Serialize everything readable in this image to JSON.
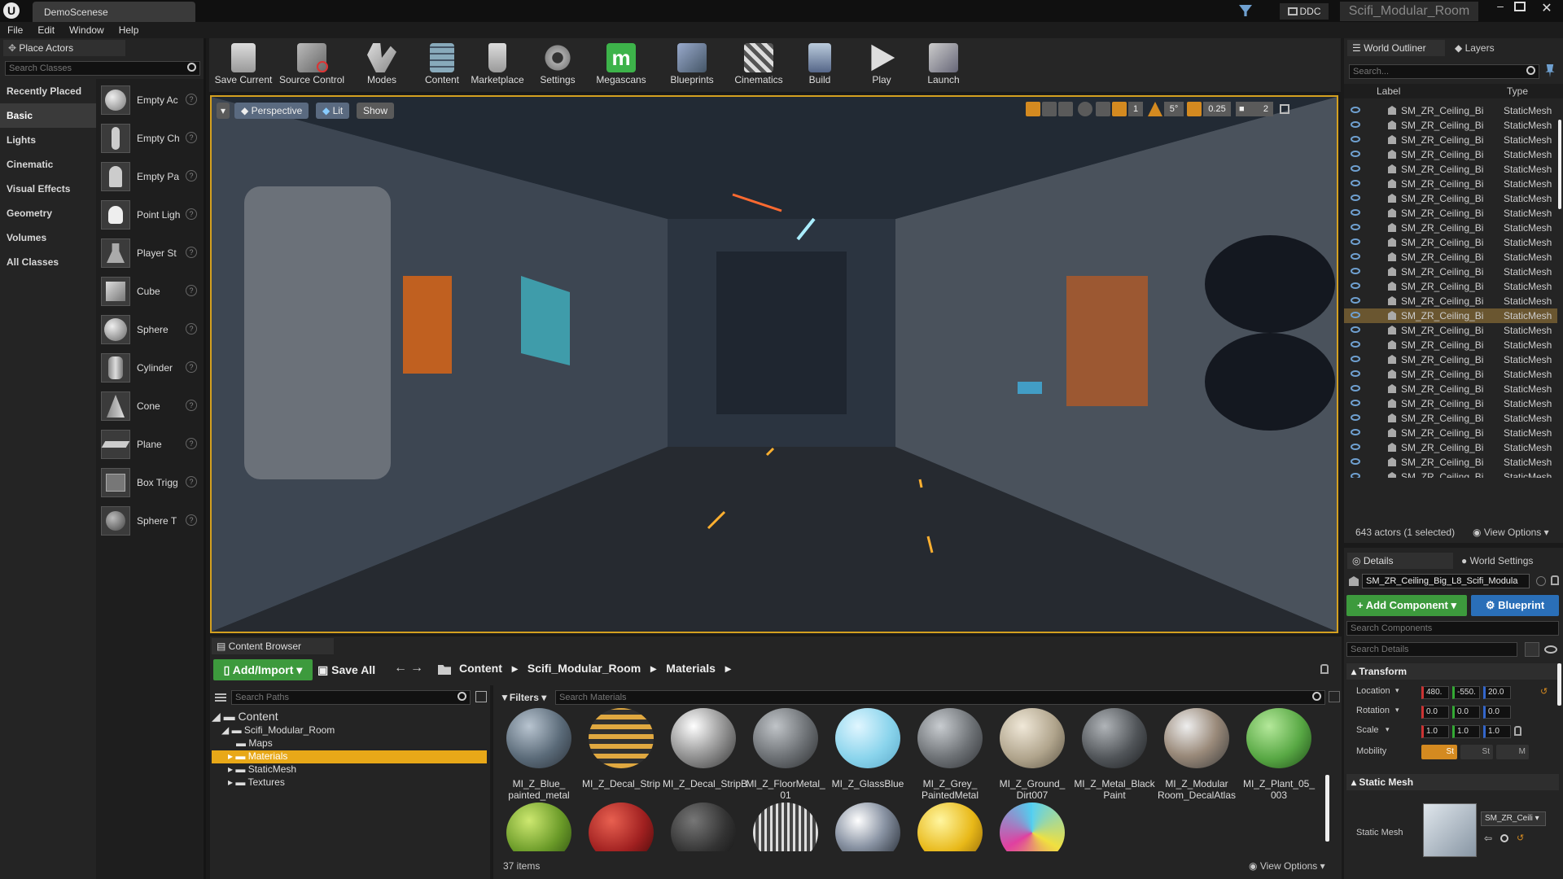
{
  "window": {
    "tab": "DemoScenese",
    "ddc": "DDC",
    "project": "Scifi_Modular_Room",
    "logo": "U"
  },
  "menu": [
    "File",
    "Edit",
    "Window",
    "Help"
  ],
  "place_actors": {
    "title": "Place Actors",
    "search_placeholder": "Search Classes",
    "categories": [
      "Recently Placed",
      "Basic",
      "Lights",
      "Cinematic",
      "Visual Effects",
      "Geometry",
      "Volumes",
      "All Classes"
    ],
    "selected_category": "Basic",
    "actors": [
      "Empty Ac",
      "Empty Ch",
      "Empty Pa",
      "Point Ligh",
      "Player St",
      "Cube",
      "Sphere",
      "Cylinder",
      "Cone",
      "Plane",
      "Box Trigg",
      "Sphere T"
    ]
  },
  "toolbar": [
    "Save Current",
    "Source Control",
    "Modes",
    "Content",
    "Marketplace",
    "Settings",
    "Megascans",
    "Blueprints",
    "Cinematics",
    "Build",
    "Play",
    "Launch"
  ],
  "viewport": {
    "perspective": "Perspective",
    "lit": "Lit",
    "show": "Show",
    "grid_value": "1",
    "angle_value": "5°",
    "scale_value": "0.25",
    "camera_speed": "2"
  },
  "outliner": {
    "tab": "World Outliner",
    "layers_tab": "Layers",
    "search_placeholder": "Search...",
    "col_label": "Label",
    "col_type": "Type",
    "row_label": "SM_ZR_Ceiling_Bi",
    "row_type": "StaticMesh",
    "row_count": 28,
    "selected_row": 14,
    "status": "643 actors (1 selected)",
    "view_options": "View Options"
  },
  "details": {
    "tab": "Details",
    "world_settings_tab": "World Settings",
    "actor_name": "SM_ZR_Ceiling_Big_L8_Scifi_Modula",
    "add_component": "+ Add Component",
    "blueprint": "Blueprint",
    "search_components": "Search Components",
    "search_details": "Search Details",
    "transform": "Transform",
    "location_label": "Location",
    "location": [
      "480.",
      "-550.",
      "20.0"
    ],
    "rotation_label": "Rotation",
    "rotation": [
      "0.0",
      "0.0",
      "0.0"
    ],
    "scale_label": "Scale",
    "scale": [
      "1.0",
      "1.0",
      "1.0"
    ],
    "mobility_label": "Mobility",
    "mobility": [
      "St",
      "St",
      "M"
    ],
    "static_mesh_section": "Static Mesh",
    "static_mesh_label": "Static Mesh",
    "static_mesh_value": "SM_ZR_Ceili"
  },
  "content_browser": {
    "tab": "Content Browser",
    "add_import": "Add/Import",
    "save_all": "Save All",
    "breadcrumb": [
      "Content",
      "Scifi_Modular_Room",
      "Materials"
    ],
    "search_paths": "Search Paths",
    "filters": "Filters",
    "search_materials": "Search Materials",
    "tree": [
      "Content",
      "Scifi_Modular_Room",
      "Maps",
      "Materials",
      "StaticMesh",
      "Textures"
    ],
    "selected_folder": "Materials",
    "materials_row1": [
      "MI_Z_Blue_ painted_metal",
      "MI_Z_Decal_Strip",
      "MI_Z_Decal_StripB",
      "MI_Z_FloorMetal_ 01",
      "MI_Z_GlassBlue",
      "MI_Z_Grey_ PaintedMetal",
      "MI_Z_Ground_ Dirt007",
      "MI_Z_Metal_Black Paint",
      "MI_Z_Modular Room_DecalAtlas",
      "MI_Z_Plant_05_ 003"
    ],
    "item_count": "37 items",
    "view_options": "View Options"
  },
  "colors": {
    "accent": "#d4a020",
    "green": "#3d9a3d",
    "blue": "#2a6fb8",
    "panel": "#242424"
  }
}
